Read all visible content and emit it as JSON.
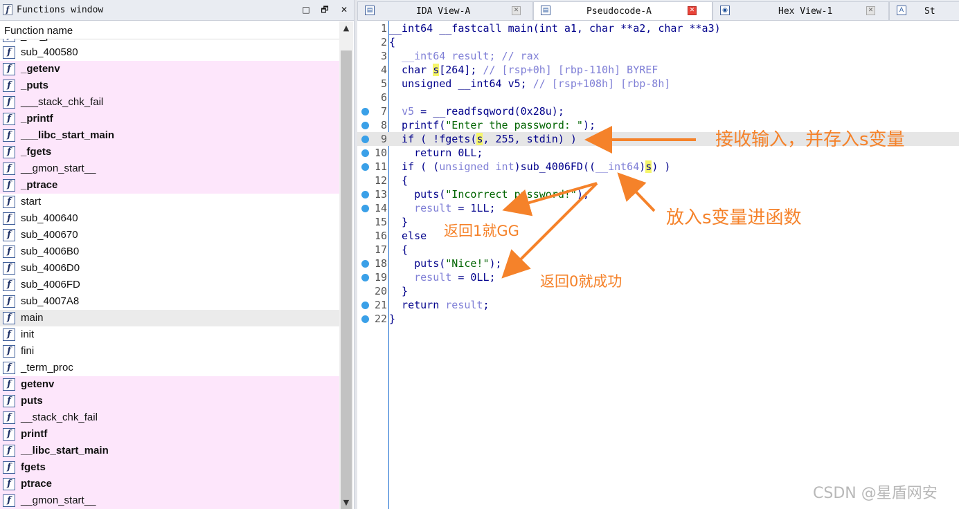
{
  "functions_window": {
    "title": "Functions window",
    "column_header": "Function name",
    "icon_glyph": "f",
    "btn_minimize": "□",
    "btn_float": "🗗",
    "btn_close": "✕",
    "partial_top": "_init_proc",
    "items": [
      {
        "name": "sub_400580",
        "bold": false,
        "pink": false
      },
      {
        "name": "_getenv",
        "bold": true,
        "pink": true
      },
      {
        "name": "_puts",
        "bold": true,
        "pink": true
      },
      {
        "name": "___stack_chk_fail",
        "bold": false,
        "pink": true
      },
      {
        "name": "_printf",
        "bold": true,
        "pink": true
      },
      {
        "name": "___libc_start_main",
        "bold": true,
        "pink": true
      },
      {
        "name": "_fgets",
        "bold": true,
        "pink": true
      },
      {
        "name": "__gmon_start__",
        "bold": false,
        "pink": true
      },
      {
        "name": "_ptrace",
        "bold": true,
        "pink": true
      },
      {
        "name": "start",
        "bold": false,
        "pink": false
      },
      {
        "name": "sub_400640",
        "bold": false,
        "pink": false
      },
      {
        "name": "sub_400670",
        "bold": false,
        "pink": false
      },
      {
        "name": "sub_4006B0",
        "bold": false,
        "pink": false
      },
      {
        "name": "sub_4006D0",
        "bold": false,
        "pink": false
      },
      {
        "name": "sub_4006FD",
        "bold": false,
        "pink": false
      },
      {
        "name": "sub_4007A8",
        "bold": false,
        "pink": false
      },
      {
        "name": "main",
        "bold": false,
        "pink": false,
        "selected": true
      },
      {
        "name": "init",
        "bold": false,
        "pink": false
      },
      {
        "name": "fini",
        "bold": false,
        "pink": false
      },
      {
        "name": "_term_proc",
        "bold": false,
        "pink": false
      },
      {
        "name": "getenv",
        "bold": true,
        "pink": true
      },
      {
        "name": "puts",
        "bold": true,
        "pink": true
      },
      {
        "name": "__stack_chk_fail",
        "bold": false,
        "pink": true
      },
      {
        "name": "printf",
        "bold": true,
        "pink": true
      },
      {
        "name": "__libc_start_main",
        "bold": true,
        "pink": true
      },
      {
        "name": "fgets",
        "bold": true,
        "pink": true
      },
      {
        "name": "ptrace",
        "bold": true,
        "pink": true
      },
      {
        "name": "__gmon_start__",
        "bold": false,
        "pink": true
      }
    ]
  },
  "scrollbar": {
    "up": "▲",
    "down": "▼"
  },
  "tabs": [
    {
      "label": "IDA View-A",
      "icon": "▤",
      "close": "✕",
      "active": false
    },
    {
      "label": "Pseudocode-A",
      "icon": "▤",
      "close": "✕",
      "active": true
    },
    {
      "label": "Hex View-1",
      "icon": "◉",
      "close": "✕",
      "active": false
    },
    {
      "label": "St",
      "icon": "A",
      "close": "",
      "active": false
    }
  ],
  "code": {
    "breakpoint_lines": [
      7,
      8,
      9,
      10,
      11,
      13,
      14,
      18,
      19,
      21,
      22
    ],
    "highlight_line": 9,
    "lines": [
      {
        "n": "1",
        "html": "__int64 __fastcall main(int a1, char **a2, char **a3)"
      },
      {
        "n": "2",
        "html": "{"
      },
      {
        "n": "3",
        "html": "  <span class='c'>__int64 result; // rax</span>"
      },
      {
        "n": "4",
        "html": "  char <span class='hv'>s</span>[264]; <span class='c'>// [rsp+0h] [rbp-110h] BYREF</span>"
      },
      {
        "n": "5",
        "html": "  unsigned __int64 v5; <span class='c'>// [rsp+108h] [rbp-8h]</span>"
      },
      {
        "n": "6",
        "html": ""
      },
      {
        "n": "7",
        "html": "  <span class='c'>v5</span> = __readfsqword(0x28u);"
      },
      {
        "n": "8",
        "html": "  printf(<span class='s'>\"Enter the password: \"</span>);"
      },
      {
        "n": "9",
        "html": "  if ( !fgets(<span class='hv'>s</span>, 255, stdin) )"
      },
      {
        "n": "10",
        "html": "    return 0LL;"
      },
      {
        "n": "11",
        "html": "  if ( (<span class='c'>unsigned int</span>)sub_4006FD((<span class='c'>__int64</span>)<span class='hv'>s</span>) )"
      },
      {
        "n": "12",
        "html": "  {"
      },
      {
        "n": "13",
        "html": "    puts(<span class='s'>\"Incorrect password!\"</span>);"
      },
      {
        "n": "14",
        "html": "    <span class='c'>result</span> = 1LL;"
      },
      {
        "n": "15",
        "html": "  }"
      },
      {
        "n": "16",
        "html": "  else"
      },
      {
        "n": "17",
        "html": "  {"
      },
      {
        "n": "18",
        "html": "    puts(<span class='s'>\"Nice!\"</span>);"
      },
      {
        "n": "19",
        "html": "    <span class='c'>result</span> = 0LL;"
      },
      {
        "n": "20",
        "html": "  }"
      },
      {
        "n": "21",
        "html": "  return <span class='c'>result</span>;"
      },
      {
        "n": "22",
        "html": "}"
      }
    ]
  },
  "annotations": {
    "receive_input": "接收输入，并存入s变量",
    "pass_to_func": "放入s变量进函数",
    "return1": "返回1就GG",
    "return0": "返回0就成功",
    "arrow_color": "#f5822a"
  },
  "watermark": "CSDN @星盾网安"
}
